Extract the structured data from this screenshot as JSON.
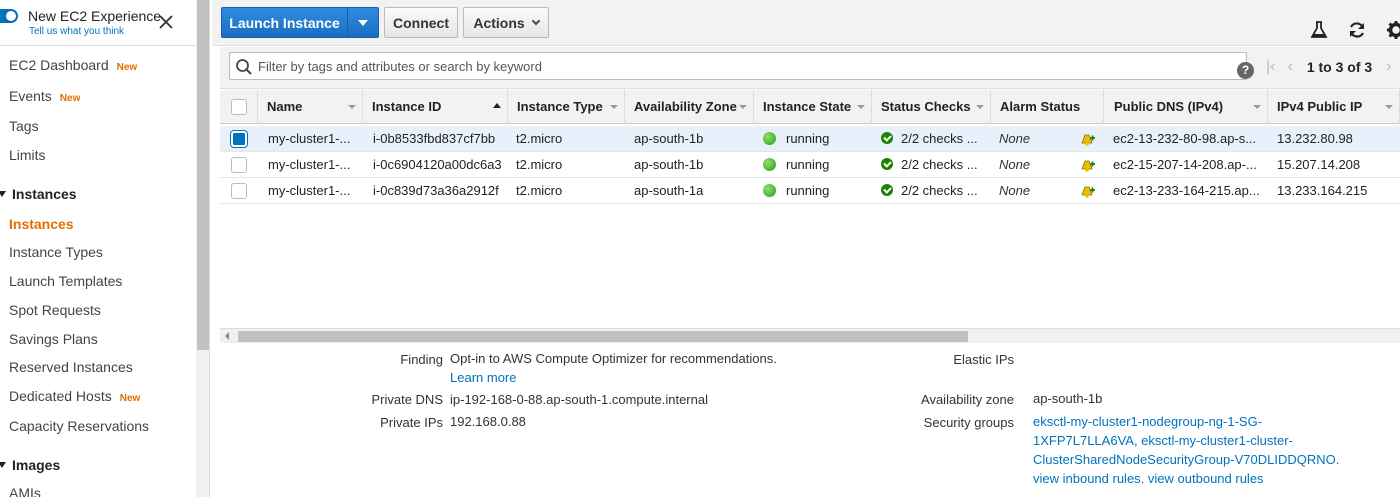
{
  "sidebar": {
    "title": "New EC2 Experience",
    "subtitle": "Tell us what you think",
    "items": [
      {
        "label": "EC2 Dashboard",
        "badge": "New"
      },
      {
        "label": "Events",
        "badge": "New"
      },
      {
        "label": "Tags",
        "badge": ""
      },
      {
        "label": "Limits",
        "badge": ""
      }
    ],
    "instances_section": "Instances",
    "instance_items": [
      {
        "label": "Instances",
        "badge": "",
        "active": true
      },
      {
        "label": "Instance Types",
        "badge": ""
      },
      {
        "label": "Launch Templates",
        "badge": ""
      },
      {
        "label": "Spot Requests",
        "badge": ""
      },
      {
        "label": "Savings Plans",
        "badge": ""
      },
      {
        "label": "Reserved Instances",
        "badge": ""
      },
      {
        "label": "Dedicated Hosts",
        "badge": "New"
      },
      {
        "label": "Capacity Reservations",
        "badge": ""
      }
    ],
    "images_section": "Images",
    "images_items": [
      {
        "label": "AMIs"
      }
    ]
  },
  "toolbar": {
    "launch_label": "Launch Instance",
    "connect_label": "Connect",
    "actions_label": "Actions"
  },
  "search": {
    "placeholder": "Filter by tags and attributes or search by keyword",
    "value": "",
    "help": "?"
  },
  "pager": {
    "text": "1 to 3 of 3"
  },
  "table": {
    "columns": [
      "Name",
      "Instance ID",
      "Instance Type",
      "Availability Zone",
      "Instance State",
      "Status Checks",
      "Alarm Status",
      "Public DNS (IPv4)",
      "IPv4 Public IP"
    ],
    "rows": [
      {
        "name": "my-cluster1-...",
        "id": "i-0b8533fbd837cf7bb",
        "type": "t2.micro",
        "az": "ap-south-1b",
        "state": "running",
        "checks": "2/2 checks ...",
        "alarm": "None",
        "dns": "ec2-13-232-80-98.ap-s...",
        "ip": "13.232.80.98",
        "selected": true
      },
      {
        "name": "my-cluster1-...",
        "id": "i-0c6904120a00dc6a3",
        "type": "t2.micro",
        "az": "ap-south-1b",
        "state": "running",
        "checks": "2/2 checks ...",
        "alarm": "None",
        "dns": "ec2-15-207-14-208.ap-...",
        "ip": "15.207.14.208",
        "selected": false
      },
      {
        "name": "my-cluster1-...",
        "id": "i-0c839d73a36a2912f",
        "type": "t2.micro",
        "az": "ap-south-1a",
        "state": "running",
        "checks": "2/2 checks ...",
        "alarm": "None",
        "dns": "ec2-13-233-164-215.ap...",
        "ip": "13.233.164.215",
        "selected": false
      }
    ]
  },
  "details": {
    "finding_label": "Finding",
    "finding_value": "Opt-in to AWS Compute Optimizer for recommendations.",
    "learn_more": "Learn more",
    "private_dns_label": "Private DNS",
    "private_dns_value": "ip-192-168-0-88.ap-south-1.compute.internal",
    "private_ips_label": "Private IPs",
    "private_ips_value": "192.168.0.88",
    "elastic_ips_label": "Elastic IPs",
    "az_label": "Availability zone",
    "az_value": "ap-south-1b",
    "sg_label": "Security groups",
    "sg_line1": "eksctl-my-cluster1-nodegroup-ng-1-SG-",
    "sg_line2": "1XFP7L7LLA6VA, eksctl-my-cluster1-cluster-",
    "sg_line3": "ClusterSharedNodeSecurityGroup-V70DLIDDQRNO.",
    "view_inbound": "view inbound rules",
    "view_outbound": "view outbound rules"
  },
  "colors": {
    "primary": "#1a6fc0",
    "link": "#0073bb",
    "active_nav": "#e07000",
    "running": "#2a9a1c"
  }
}
